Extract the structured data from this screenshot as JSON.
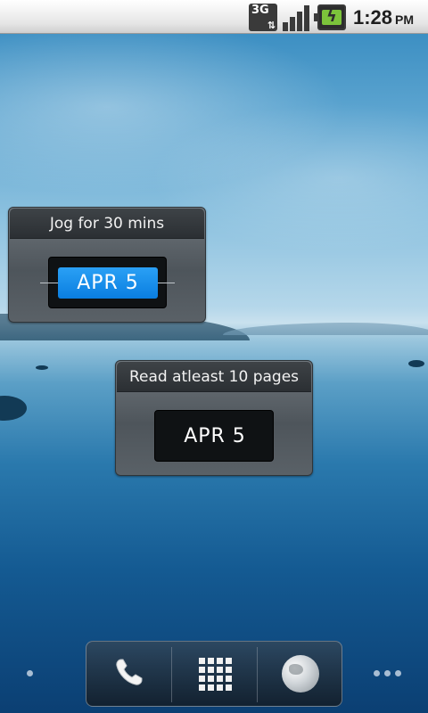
{
  "status_bar": {
    "network_label": "3G",
    "time": "1:28",
    "ampm": "PM",
    "icons": [
      "network-3g-icon",
      "signal-strength-icon",
      "battery-charging-icon"
    ]
  },
  "widgets": [
    {
      "title": "Jog for 30 mins",
      "date": "APR  5",
      "state": "highlighted"
    },
    {
      "title": "Read atleast 10 pages",
      "date": "APR  5",
      "state": "normal"
    }
  ],
  "dock": {
    "items": [
      {
        "name": "phone",
        "icon": "phone-icon"
      },
      {
        "name": "app-drawer",
        "icon": "grid-icon"
      },
      {
        "name": "browser",
        "icon": "globe-icon"
      }
    ]
  },
  "home_screen": {
    "left_page_indicator": "single-dot",
    "right_page_indicator": "three-dots"
  },
  "colors": {
    "accent_blue": "#0a7ee0",
    "widget_dark": "#2b2f33"
  }
}
